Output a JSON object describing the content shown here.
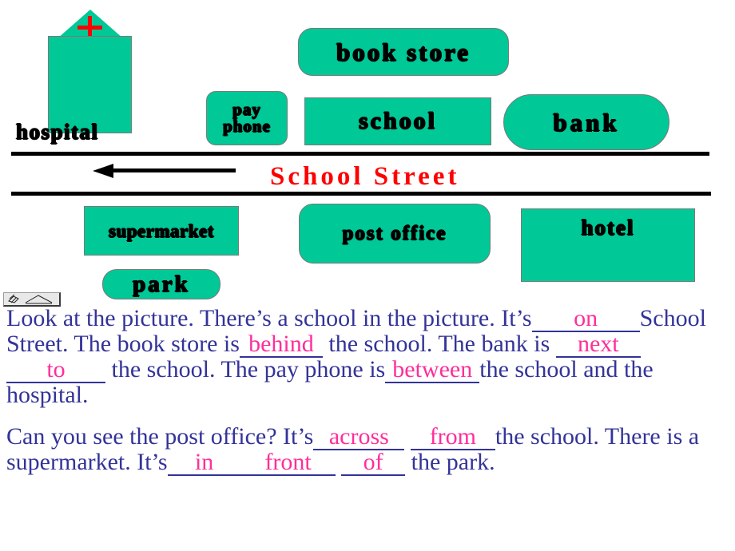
{
  "map": {
    "buildings": [
      {
        "name": "hospital",
        "label": "hospital"
      },
      {
        "name": "pay-phone",
        "label_line1": "pay",
        "label_line2": "phone"
      },
      {
        "name": "book-store",
        "label": "book store"
      },
      {
        "name": "school",
        "label": "school"
      },
      {
        "name": "bank",
        "label": "bank"
      },
      {
        "name": "supermarket",
        "label": "supermarket"
      },
      {
        "name": "post-office",
        "label": "post office"
      },
      {
        "name": "hotel",
        "label": "hotel"
      },
      {
        "name": "park",
        "label": "park"
      }
    ],
    "street_name": "School   Street",
    "colors": {
      "building_fill": "#00c896",
      "building_outline": "#7a7a7a",
      "street_text": "#ff0000",
      "hospital_cross": "#ff0000",
      "road": "#000000"
    },
    "icons": {
      "direction_arrow": "arrow-left-icon",
      "hospital_cross": "red-cross-icon"
    }
  },
  "toolbar": {
    "icons": [
      "wordart-icon",
      "line-draw-icon"
    ]
  },
  "exercise": {
    "colors": {
      "body_text": "#333399",
      "answer_text": "#ff2e9a"
    },
    "paragraph1": {
      "t1": "Look at the picture. There’s a school in the picture.",
      "t2": "It’s",
      "a1": "on",
      "t3": "School Street. The book store is",
      "a2": "behind",
      "t4": "the school. The bank is",
      "a3": "next",
      "a4": "to",
      "t5": "the school.",
      "t6": "The pay phone is",
      "a5": "between",
      "t7": "the school and the hospital."
    },
    "paragraph2": {
      "t1": "Can you see the post office? It’s",
      "a1": "across",
      "a2": "from",
      "t2": "the",
      "t3": "school. There is a supermarket. It’s",
      "a3": "in",
      "a4": "front",
      "a5": "of",
      "t4": "the park."
    }
  }
}
